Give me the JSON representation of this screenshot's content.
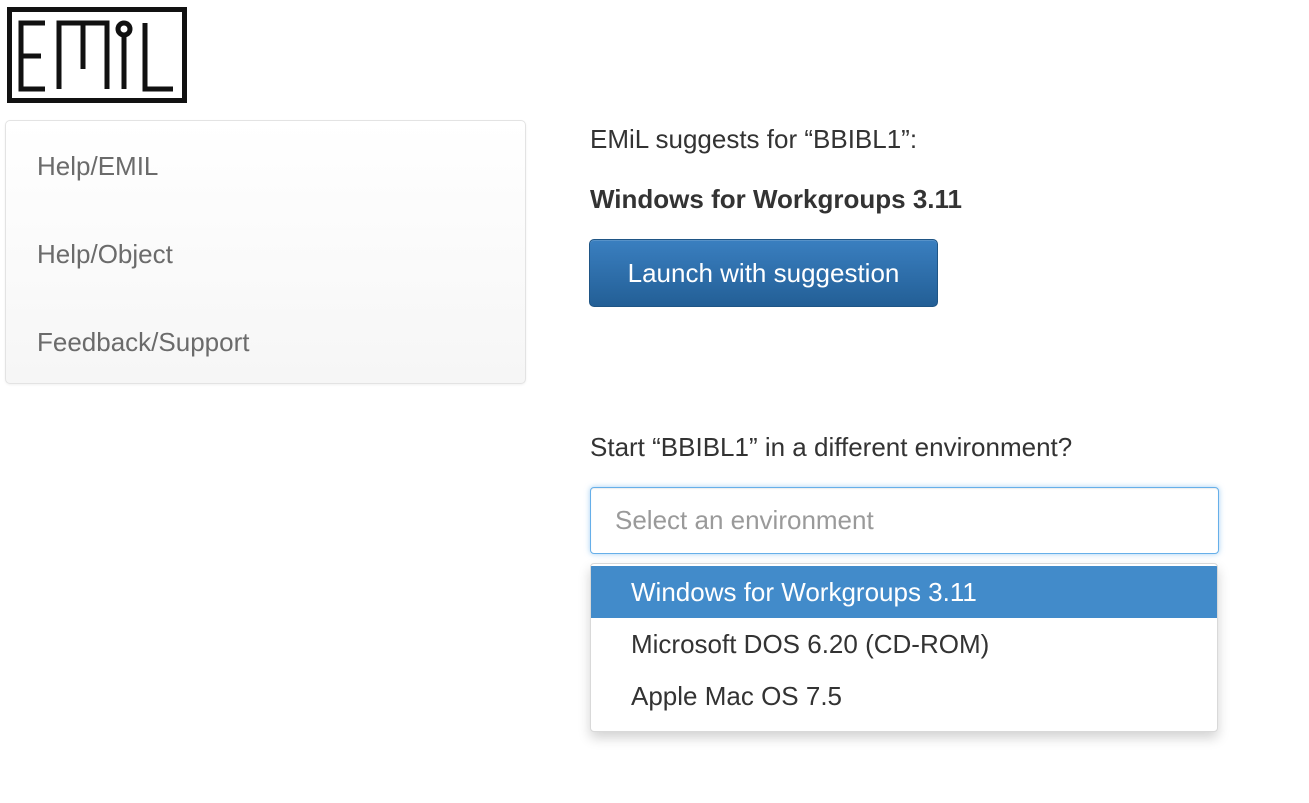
{
  "logo": {
    "text": "EMiL",
    "icon": "emil-logo-icon"
  },
  "sidebar": {
    "items": [
      {
        "label": "Help/EMIL"
      },
      {
        "label": "Help/Object"
      },
      {
        "label": "Feedback/Support"
      }
    ]
  },
  "suggestion": {
    "label": "EMiL suggests for “BBIBL1”:",
    "environment": "Windows for Workgroups 3.11",
    "launch_label": "Launch with suggestion"
  },
  "alternative": {
    "label": "Start “BBIBL1” in a different environment?",
    "input_value": "",
    "input_placeholder": "Select an environment",
    "options": [
      {
        "label": "Windows for Workgroups 3.11",
        "highlighted": true
      },
      {
        "label": "Microsoft DOS 6.20 (CD-ROM)",
        "highlighted": false
      },
      {
        "label": "Apple Mac OS 7.5",
        "highlighted": false
      }
    ]
  },
  "colors": {
    "primary_button": "#2a6aa5",
    "highlight": "#428bca",
    "focus_border": "#66afe9"
  }
}
